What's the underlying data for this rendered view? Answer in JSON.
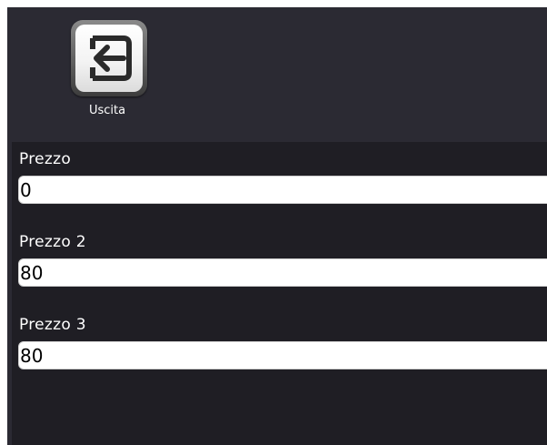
{
  "toolbar": {
    "exit_label": "Uscita",
    "exit_icon": "exit-arrow-icon"
  },
  "form": {
    "fields": [
      {
        "label": "Prezzo",
        "value": "0"
      },
      {
        "label": "Prezzo 2",
        "value": "80"
      },
      {
        "label": "Prezzo 3",
        "value": "80"
      }
    ]
  },
  "colors": {
    "toolbar_bg": "#2b2a33",
    "form_bg": "#1f1e24",
    "icon_arrow": "#2a2a2a"
  }
}
